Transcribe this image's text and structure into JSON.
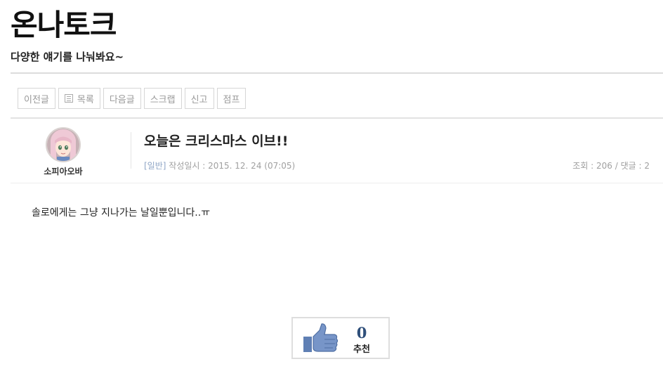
{
  "board": {
    "title": "온나토크",
    "subtitle": "다양한 얘기를 나눠봐요~"
  },
  "toolbar": {
    "prev": "이전글",
    "list": "목록",
    "next": "다음글",
    "scrap": "스크랩",
    "report": "신고",
    "jump": "점프"
  },
  "post": {
    "author": "소피아오바",
    "title": "오늘은 크리스마스 이브!!",
    "category": "[일반]",
    "date_text": "작성일시 : 2015. 12. 24 (07:05)",
    "stats": "조회 : 206 / 댓글 : 2",
    "body": "솔로에게는 그냥 지나가는 날일뿐입니다..ㅠ"
  },
  "recommend": {
    "count": "0",
    "label": "추천"
  },
  "colors": {
    "category": "#8fa6c6",
    "recommend_count": "#2f4f7a",
    "thumb": "#5f7fb4"
  },
  "icons": [
    "list-icon",
    "thumbs-up-icon",
    "avatar"
  ]
}
